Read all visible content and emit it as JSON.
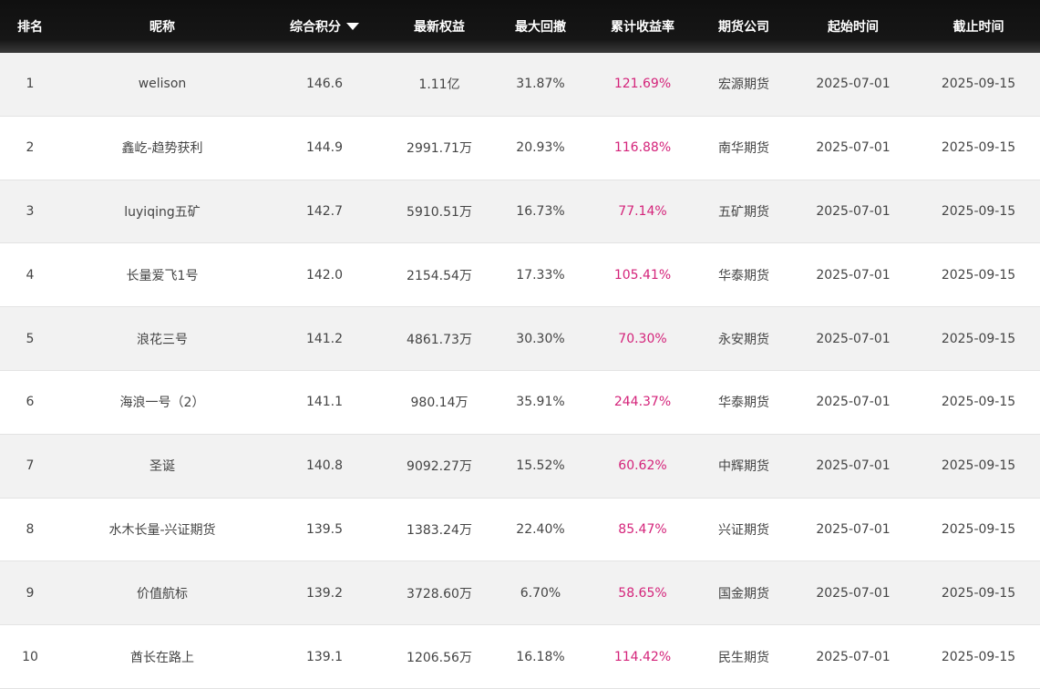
{
  "header": {
    "rank": "排名",
    "nickname": "昵称",
    "score": "综合积分",
    "sort_icon": "caret-down-icon",
    "equity": "最新权益",
    "max_drawdown": "最大回撤",
    "return": "累计收益率",
    "company": "期货公司",
    "start": "起始时间",
    "end": "截止时间"
  },
  "colors": {
    "header_bg": "#111111",
    "return_color": "#d4237a",
    "stripe": "#f2f2f2"
  },
  "rows": [
    {
      "rank": "1",
      "nickname": "welison",
      "score": "146.6",
      "equity": "1.11亿",
      "drawdown": "31.87%",
      "return": "121.69%",
      "company": "宏源期货",
      "start": "2025-07-01",
      "end": "2025-09-15"
    },
    {
      "rank": "2",
      "nickname": "鑫屹-趋势获利",
      "score": "144.9",
      "equity": "2991.71万",
      "drawdown": "20.93%",
      "return": "116.88%",
      "company": "南华期货",
      "start": "2025-07-01",
      "end": "2025-09-15"
    },
    {
      "rank": "3",
      "nickname": "luyiqing五矿",
      "score": "142.7",
      "equity": "5910.51万",
      "drawdown": "16.73%",
      "return": "77.14%",
      "company": "五矿期货",
      "start": "2025-07-01",
      "end": "2025-09-15"
    },
    {
      "rank": "4",
      "nickname": "长量爱飞1号",
      "score": "142.0",
      "equity": "2154.54万",
      "drawdown": "17.33%",
      "return": "105.41%",
      "company": "华泰期货",
      "start": "2025-07-01",
      "end": "2025-09-15"
    },
    {
      "rank": "5",
      "nickname": "浪花三号",
      "score": "141.2",
      "equity": "4861.73万",
      "drawdown": "30.30%",
      "return": "70.30%",
      "company": "永安期货",
      "start": "2025-07-01",
      "end": "2025-09-15"
    },
    {
      "rank": "6",
      "nickname": "海浪一号（2）",
      "score": "141.1",
      "equity": "980.14万",
      "drawdown": "35.91%",
      "return": "244.37%",
      "company": "华泰期货",
      "start": "2025-07-01",
      "end": "2025-09-15"
    },
    {
      "rank": "7",
      "nickname": "圣诞",
      "score": "140.8",
      "equity": "9092.27万",
      "drawdown": "15.52%",
      "return": "60.62%",
      "company": "中辉期货",
      "start": "2025-07-01",
      "end": "2025-09-15"
    },
    {
      "rank": "8",
      "nickname": "水木长量-兴证期货",
      "score": "139.5",
      "equity": "1383.24万",
      "drawdown": "22.40%",
      "return": "85.47%",
      "company": "兴证期货",
      "start": "2025-07-01",
      "end": "2025-09-15"
    },
    {
      "rank": "9",
      "nickname": "价值航标",
      "score": "139.2",
      "equity": "3728.60万",
      "drawdown": "6.70%",
      "return": "58.65%",
      "company": "国金期货",
      "start": "2025-07-01",
      "end": "2025-09-15"
    },
    {
      "rank": "10",
      "nickname": "酋长在路上",
      "score": "139.1",
      "equity": "1206.56万",
      "drawdown": "16.18%",
      "return": "114.42%",
      "company": "民生期货",
      "start": "2025-07-01",
      "end": "2025-09-15"
    }
  ]
}
